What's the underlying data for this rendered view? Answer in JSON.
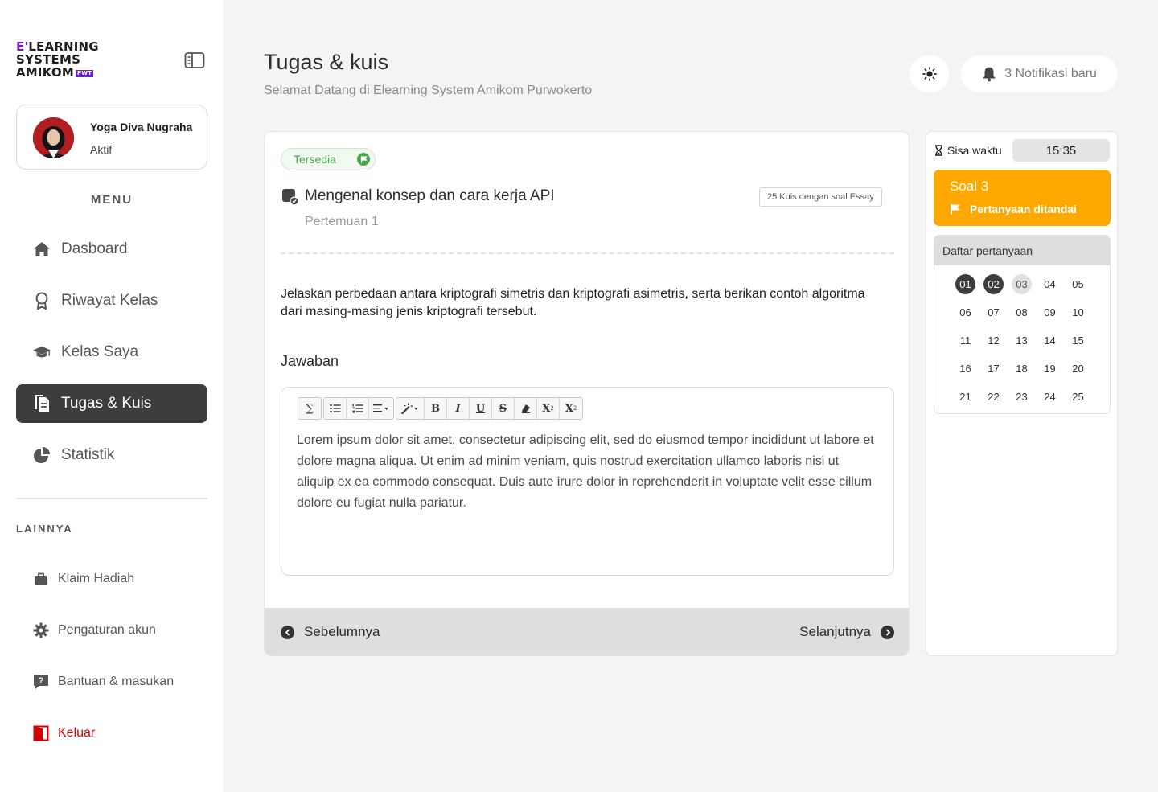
{
  "brand": {
    "line1_prefix": "E'",
    "line1": "LEARNING",
    "line2": "SYSTEMS",
    "line3": "AMIKOM",
    "tag": "PWT"
  },
  "profile": {
    "name": "Yoga Diva Nugraha",
    "status": "Aktif"
  },
  "menu": {
    "title": "MENU",
    "items": [
      {
        "label": "Dasboard",
        "icon": "home-icon"
      },
      {
        "label": "Riwayat Kelas",
        "icon": "award-icon"
      },
      {
        "label": "Kelas Saya",
        "icon": "graduation-cap-icon"
      },
      {
        "label": "Tugas & Kuis",
        "icon": "document-icon",
        "active": true
      },
      {
        "label": "Statistik",
        "icon": "pie-chart-icon"
      }
    ]
  },
  "other": {
    "title": "LAINNYA",
    "items": [
      {
        "label": "Klaim Hadiah",
        "icon": "gift-bag-icon"
      },
      {
        "label": "Pengaturan akun",
        "icon": "gear-icon"
      },
      {
        "label": "Bantuan & masukan",
        "icon": "help-icon"
      },
      {
        "label": "Keluar",
        "icon": "logout-door-icon"
      }
    ]
  },
  "header": {
    "title": "Tugas & kuis",
    "subtitle": "Selamat Datang di Elearning System Amikom Purwokerto",
    "notifications": "3 Notifikasi baru"
  },
  "quiz": {
    "status": "Tersedia",
    "title": "Mengenal konsep dan cara kerja API",
    "meta": "25 Kuis dengan soal Essay",
    "session": "Pertemuan 1",
    "question": "Jelaskan perbedaan antara kriptografi simetris dan kriptografi asimetris, serta berikan contoh algoritma dari masing-masing jenis kriptografi tersebut.",
    "answer_label": "Jawaban",
    "answer_text": "Lorem ipsum dolor sit amet, consectetur adipiscing elit, sed do eiusmod tempor incididunt ut labore et dolore magna aliqua. Ut enim ad minim veniam, quis nostrud exercitation ullamco laboris nisi ut aliquip ex ea commodo consequat. Duis aute irure dolor in reprehenderit in voluptate velit esse cillum dolore eu fugiat nulla pariatur.",
    "prev": "Sebelumnya",
    "next": "Selanjutnya"
  },
  "toolbar": {
    "sigma": "∑",
    "bold": "B",
    "italic": "I",
    "underline": "U",
    "strike": "S",
    "superscript": "X",
    "subscript": "X"
  },
  "panel": {
    "timer_label": "Sisa waktu",
    "timer_value": "15:35",
    "current_question": "Soal 3",
    "flag_label": "Pertanyaan ditandai",
    "list_title": "Daftar pertanyaan",
    "questions": [
      "01",
      "02",
      "03",
      "04",
      "05",
      "06",
      "07",
      "08",
      "09",
      "10",
      "11",
      "12",
      "13",
      "14",
      "15",
      "16",
      "17",
      "18",
      "19",
      "20",
      "21",
      "22",
      "23",
      "24",
      "25"
    ],
    "answered": [
      "01",
      "02"
    ],
    "current": "03"
  },
  "colors": {
    "accent": "#ffa800",
    "brand": "#6b21c8",
    "active_nav": "#3d3d3d",
    "available": "#4ca74c",
    "logout": "#d50000"
  }
}
